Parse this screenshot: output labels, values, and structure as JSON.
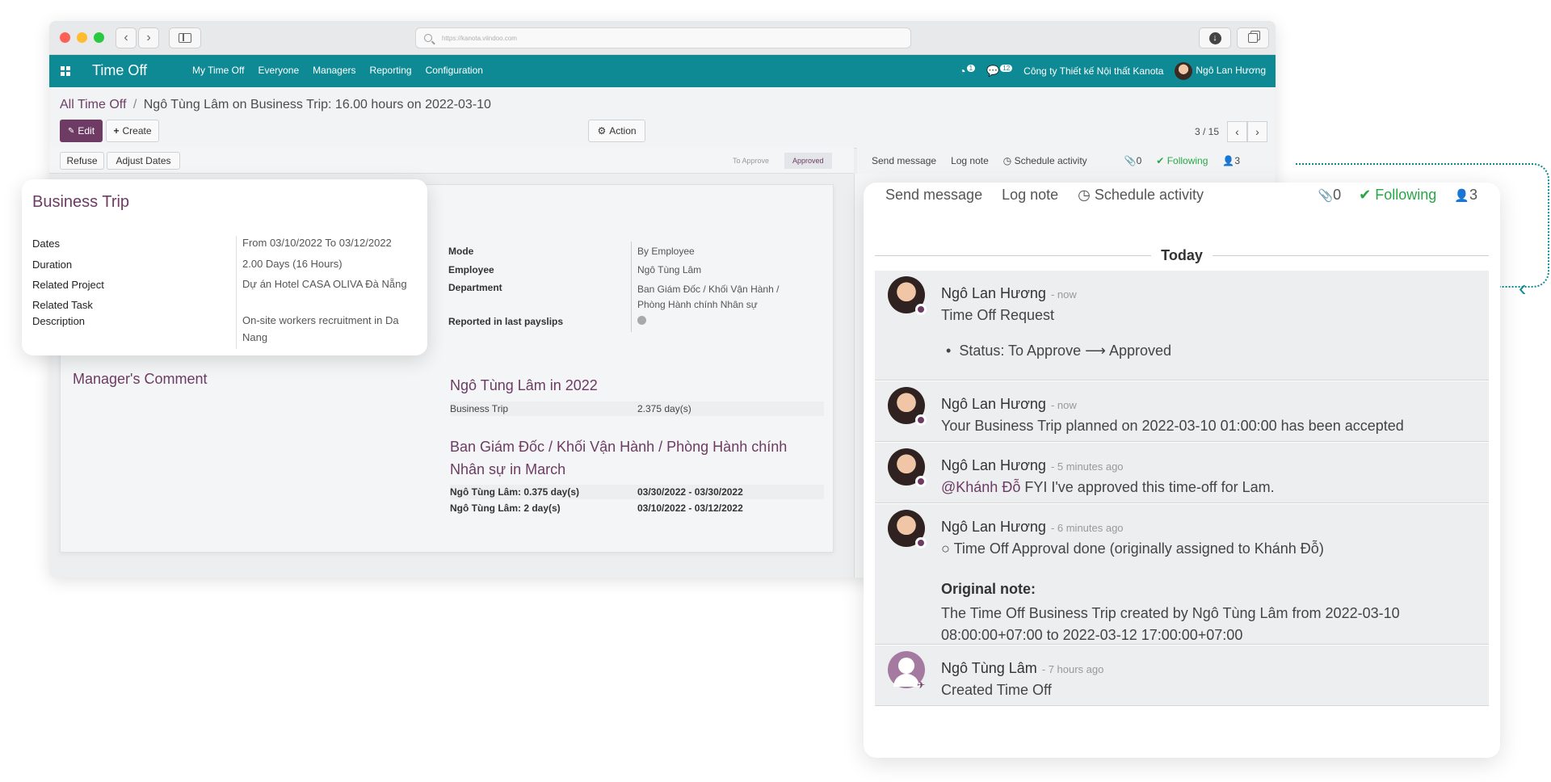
{
  "browser": {
    "url": "https://kanota.viindoo.com"
  },
  "navbar": {
    "app_title": "Time Off",
    "menu": [
      "My Time Off",
      "Everyone",
      "Managers",
      "Reporting",
      "Configuration"
    ],
    "activity_count": "1",
    "message_count": "12",
    "company": "Công ty Thiết kế Nội thất Kanota",
    "user": "Ngô Lan Hương"
  },
  "breadcrumb": {
    "parent": "All Time Off",
    "separator": "/",
    "current": "Ngô Tùng Lâm on Business Trip: 16.00 hours on 2022-03-10"
  },
  "control": {
    "edit": "Edit",
    "create": "Create",
    "action": "Action",
    "pager": "3 / 15"
  },
  "statusbar": {
    "refuse": "Refuse",
    "adjust": "Adjust Dates",
    "stages": [
      "To Approve",
      "Approved"
    ],
    "active_stage": "Approved"
  },
  "chatter_small": {
    "send": "Send message",
    "log": "Log note",
    "schedule": "Schedule activity",
    "attachments": "0",
    "following": "Following",
    "followers": "3"
  },
  "sheet": {
    "fields_right": [
      {
        "label": "Mode",
        "value": "By Employee"
      },
      {
        "label": "Employee",
        "value": "Ngô Tùng Lâm"
      },
      {
        "label": "Department",
        "value": "Ban Giám Đốc / Khối Vận Hành / Phòng Hành chính Nhân sự"
      },
      {
        "label": "Reported in last payslips",
        "value": ""
      }
    ],
    "manager_comment": "Manager's Comment",
    "year_title": "Ngô Tùng Lâm in 2022",
    "year_rows": [
      {
        "k": "Business Trip",
        "v": "2.375 day(s)"
      }
    ],
    "dept_title": "Ban Giám Đốc / Khối Vận Hành / Phòng Hành chính Nhân sự in March",
    "dept_rows": [
      {
        "k": "Ngô Tùng Lâm: 0.375 day(s)",
        "v": "03/30/2022 - 03/30/2022"
      },
      {
        "k": "Ngô Tùng Lâm: 2 day(s)",
        "v": "03/10/2022 - 03/12/2022"
      }
    ]
  },
  "card": {
    "title": "Business Trip",
    "fields": [
      {
        "label": "Dates",
        "value": "From 03/10/2022 To 03/12/2022"
      },
      {
        "label": "Duration",
        "value": "2.00 Days (16 Hours)"
      },
      {
        "label": "Related Project",
        "value": "Dự án Hotel CASA OLIVA Đà Nẵng"
      },
      {
        "label": "Related Task",
        "value": ""
      },
      {
        "label": "Description",
        "value": "On-site workers recruitment in Da Nang"
      }
    ]
  },
  "chatter": {
    "send": "Send message",
    "log": "Log note",
    "schedule": "Schedule activity",
    "attachments": "0",
    "following": "Following",
    "followers": "3",
    "today": "Today",
    "messages": [
      {
        "author": "Ngô Lan Hương",
        "time": "- now",
        "line1": "Time Off Request",
        "bullet": "Status: To Approve",
        "bullet_to": "Approved"
      },
      {
        "author": "Ngô Lan Hương",
        "time": "- now",
        "line1": "Your Business Trip planned on 2022-03-10 01:00:00 has been accepted"
      },
      {
        "author": "Ngô Lan Hương",
        "time": "- 5 minutes ago",
        "mention": "@Khánh Đỗ",
        "line1": "FYI I've approved this time-off for Lam."
      },
      {
        "author": "Ngô Lan Hương",
        "time": "- 6 minutes ago",
        "line1": "Time Off Approval done (originally assigned to Khánh Đỗ)",
        "note_label": "Original note:",
        "note": "The Time Off Business Trip created by Ngô Tùng Lâm from 2022-03-10 08:00:00+07:00 to 2022-03-12 17:00:00+07:00"
      },
      {
        "author": "Ngô Tùng Lâm",
        "time": "- 7 hours ago",
        "line1": "Created Time Off"
      }
    ]
  },
  "colors": {
    "navbar": "#0e8a95",
    "primary": "#6d3b63",
    "following": "#28a745"
  }
}
